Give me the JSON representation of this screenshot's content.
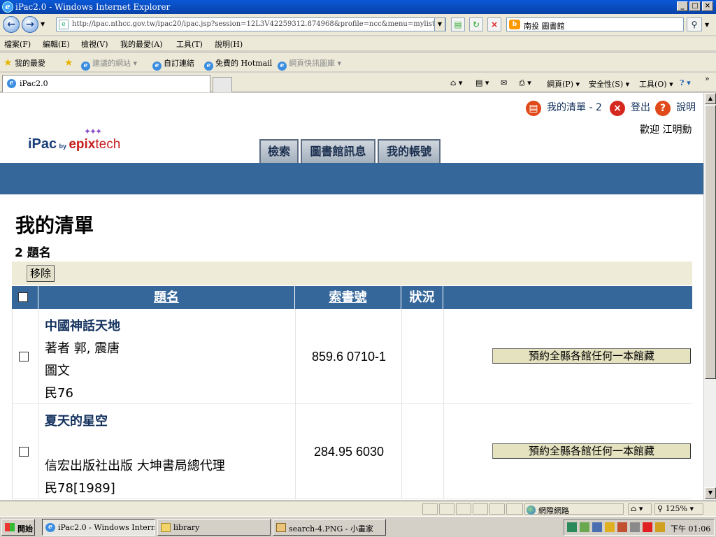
{
  "window": {
    "title": "iPac2.0 - Windows Internet Explorer",
    "controls": {
      "minimize": "_",
      "maximize": "□",
      "close": "×"
    }
  },
  "addressbar": {
    "url": "http://ipac.nthcc.gov.tw/ipac20/ipac.jsp?session=12L3V42259312.874968&profile=ncc&menu=mylist&listkey=",
    "search_value": "南投 圖書館"
  },
  "menubar": [
    "檔案(F)",
    "編輯(E)",
    "檢視(V)",
    "我的最愛(A)",
    "工具(T)",
    "說明(H)"
  ],
  "favorites": {
    "label": "我的最愛",
    "items": [
      "建議的網站",
      "自訂連結",
      "免費的 Hotmail",
      "網頁快訊圖庫"
    ]
  },
  "tabs": {
    "active": "iPac2.0"
  },
  "command_bar": {
    "page": "網頁(P)",
    "safety": "安全性(S)",
    "tools": "工具(O)"
  },
  "page": {
    "mylist_link": "我的清單 - 2",
    "logout_link": "登出",
    "help_link": "說明",
    "welcome": "歡迎 江明勳",
    "logo": {
      "ipac": "iPac",
      "by": "by",
      "epix": "epix",
      "tech": "tech"
    },
    "nav_tabs": [
      "檢索",
      "圖書館訊息",
      "我的帳號"
    ],
    "heading": "我的清單",
    "count": "2 題名",
    "remove_button": "移除",
    "table": {
      "headers": {
        "title": "題名",
        "callno": "索書號",
        "status": "狀況"
      },
      "rows": [
        {
          "title": "中國神話天地",
          "lines": [
            "著者 郭, 震唐",
            "圖文",
            "民76"
          ],
          "callno": "859.6 0710-1",
          "status": "",
          "hold_button": "預約全縣各館任何一本館藏"
        },
        {
          "title": "夏天的星空",
          "lines": [
            "",
            "信宏出版社出版 大坤書局總代理",
            "民78[1989]"
          ],
          "callno": "284.95 6030",
          "status": "",
          "hold_button": "預約全縣各館任何一本館藏"
        }
      ]
    }
  },
  "statusbar": {
    "zone": "網際網路",
    "zoom": "125%"
  },
  "taskbar": {
    "start": "開始",
    "buttons": [
      "iPac2.0 - Windows Intern...",
      "library",
      "search-4.PNG - 小畫家"
    ],
    "clock": "下午 01:06"
  }
}
